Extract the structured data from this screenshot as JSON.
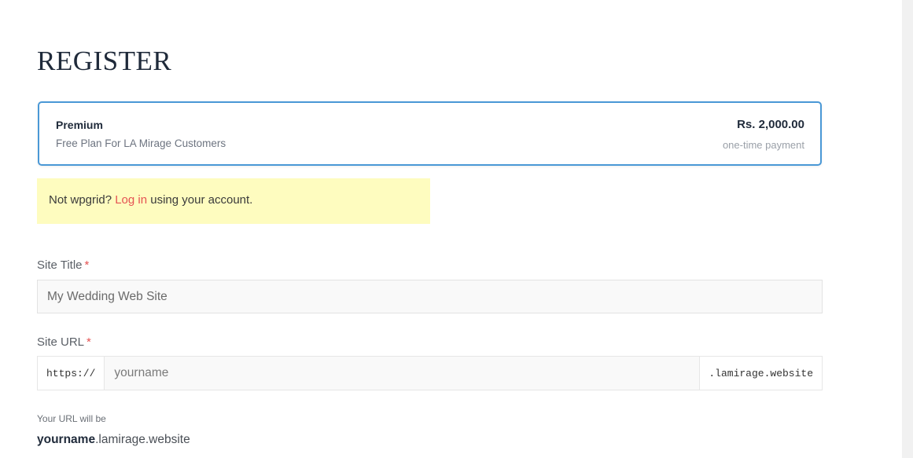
{
  "page": {
    "title": "REGISTER"
  },
  "plan": {
    "name": "Premium",
    "description": "Free Plan For LA Mirage Customers",
    "price": "Rs. 2,000.00",
    "term": "one-time payment"
  },
  "notice": {
    "prefix": "Not wpgrid? ",
    "link": "Log in",
    "suffix": " using your account."
  },
  "site_title": {
    "label": "Site Title",
    "required": "*",
    "placeholder": "My Wedding Web Site"
  },
  "site_url": {
    "label": "Site URL",
    "required": "*",
    "prefix": "https://",
    "placeholder": "yourname",
    "suffix": ".lamirage.website",
    "hint": "Your URL will be",
    "preview_name": "yourname",
    "preview_domain": ".lamirage.website"
  },
  "colors": {
    "accent": "#4a98d6",
    "link": "#e55353",
    "notice_bg": "#fefcbf"
  }
}
